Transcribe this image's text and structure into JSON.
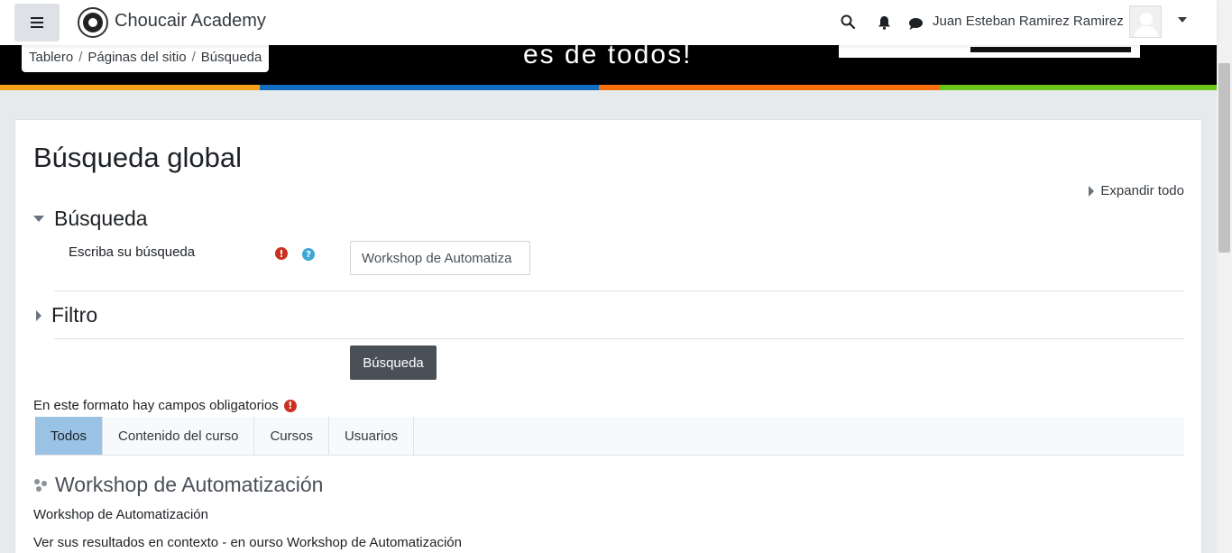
{
  "navbar": {
    "brand": "Choucair Academy",
    "username": "Juan Esteban Ramirez Ramirez"
  },
  "banner": {
    "text": "es de todos!",
    "stripe_colors": [
      "#f7a21b",
      "#0f6cbf",
      "#fa6e0b",
      "#6bc41b"
    ]
  },
  "breadcrumb": {
    "items": [
      "Tablero",
      "Páginas del sitio",
      "Búsqueda"
    ],
    "separator": "/"
  },
  "page": {
    "title": "Búsqueda global",
    "expand_all": "Expandir todo"
  },
  "sections": {
    "search": {
      "header": "Búsqueda",
      "field_label": "Escriba su búsqueda",
      "input_value": "Workshop de Automatiza"
    },
    "filter": {
      "header": "Filtro"
    }
  },
  "form": {
    "submit_label": "Búsqueda",
    "required_note": "En este formato hay campos obligatorios"
  },
  "tabs": [
    {
      "label": "Todos",
      "active": true
    },
    {
      "label": "Contenido del curso",
      "active": false
    },
    {
      "label": "Cursos",
      "active": false
    },
    {
      "label": "Usuarios",
      "active": false
    }
  ],
  "result": {
    "title": "Workshop de Automatización",
    "description": "Workshop de Automatización",
    "context": "Ver sus resultados en contexto - en ourso Workshop de Automatización"
  },
  "colors": {
    "required": "#ca3120",
    "help": "#3fa7d6",
    "active_tab": "#9ac2e4",
    "button": "#495057"
  },
  "icons": [
    "hamburger-icon",
    "logo-icon",
    "search-icon",
    "bell-icon",
    "chat-icon",
    "avatar-icon",
    "chevron-down-icon",
    "expand-triangle-icon",
    "collapse-triangle-icon",
    "required-icon",
    "help-icon",
    "course-icon"
  ]
}
